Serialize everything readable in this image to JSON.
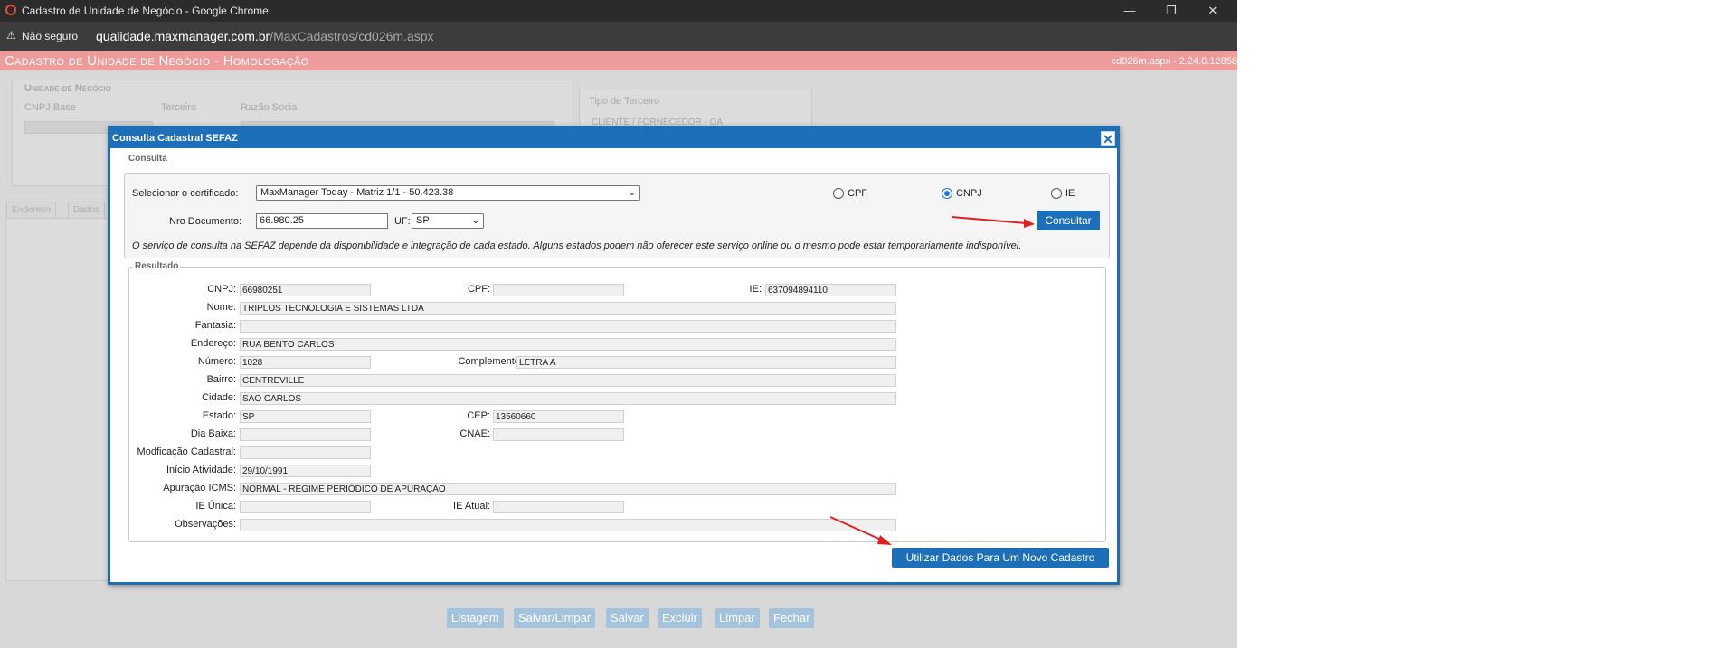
{
  "browser": {
    "window_title": "Cadastro de Unidade de Negócio - Google Chrome",
    "security_label": "Não seguro",
    "url_domain": "qualidade.maxmanager.com.br",
    "url_path": "/MaxCadastros/cd026m.aspx"
  },
  "app": {
    "title": "Cadastro de Unidade de Negócio - Homologação",
    "version": "cd026m.aspx - 2.24.0.12858"
  },
  "background": {
    "section_title": "Unidade de Negócio",
    "labels": [
      "CNPJ Base",
      "Terceiro",
      "Razão Social",
      "Tipo de Terceiro"
    ],
    "tipo_terceiro_value": "CLIENTE / FORNECEDOR - OA",
    "tabs": [
      "Endereço",
      "Dados"
    ],
    "buttons": [
      "Listagem",
      "Salvar/Limpar",
      "Salvar",
      "Excluir",
      "Limpar",
      "Fechar"
    ]
  },
  "modal": {
    "title": "Consulta Cadastral SEFAZ",
    "consulta": {
      "legend": "Consulta",
      "cert_label": "Selecionar o certificado:",
      "cert_value": "MaxManager Today - Matriz 1/1 - 50.423.38",
      "doc_label": "Nro Documento:",
      "doc_value": "66.980.25",
      "uf_label": "UF:",
      "uf_value": "SP",
      "radio_options": [
        "CPF",
        "CNPJ",
        "IE"
      ],
      "radio_selected": "CNPJ",
      "consultar_label": "Consultar",
      "note": "O serviço de consulta na SEFAZ depende da disponibilidade e integração de cada estado. Alguns estados podem não oferecer este serviço online ou o mesmo pode estar temporariamente indisponível."
    },
    "resultado": {
      "legend": "Resultado",
      "cnpj_label": "CNPJ:",
      "cnpj": "66980251",
      "cpf_label": "CPF:",
      "cpf": "",
      "ie_label": "IE:",
      "ie": "637094894110",
      "nome_label": "Nome:",
      "nome": "TRIPLOS TECNOLOGIA E SISTEMAS LTDA",
      "fantasia_label": "Fantasia:",
      "fantasia": "",
      "endereco_label": "Endereço:",
      "endereco": "RUA BENTO CARLOS",
      "numero_label": "Número:",
      "numero": "1028",
      "complemento_label": "Complemento:",
      "complemento": "LETRA A",
      "bairro_label": "Bairro:",
      "bairro": "CENTREVILLE",
      "cidade_label": "Cidade:",
      "cidade": "SAO CARLOS",
      "estado_label": "Estado:",
      "estado": "SP",
      "cep_label": "CEP:",
      "cep": "13560660",
      "dia_baixa_label": "Dia Baixa:",
      "dia_baixa": "",
      "cnae_label": "CNAE:",
      "cnae": "",
      "mod_cadastral_label": "Modficação Cadastral:",
      "mod_cadastral": "",
      "inicio_atividade_label": "Início Atividade:",
      "inicio_atividade": "29/10/1991",
      "apuracao_icms_label": "Apuração ICMS:",
      "apuracao_icms": "NORMAL - REGIME PERIÓDICO DE APURAÇÃO",
      "ie_unica_label": "IE Única:",
      "ie_unica": "",
      "ie_atual_label": "IE Atual:",
      "ie_atual": "",
      "observacoes_label": "Observações:",
      "observacoes": ""
    },
    "use_data_label": "Utilizar Dados Para Um Novo Cadastro"
  },
  "colors": {
    "modal_blue": "#1c6fb8",
    "header_pink": "#ed9b9b",
    "annotation_red": "#e02020"
  }
}
